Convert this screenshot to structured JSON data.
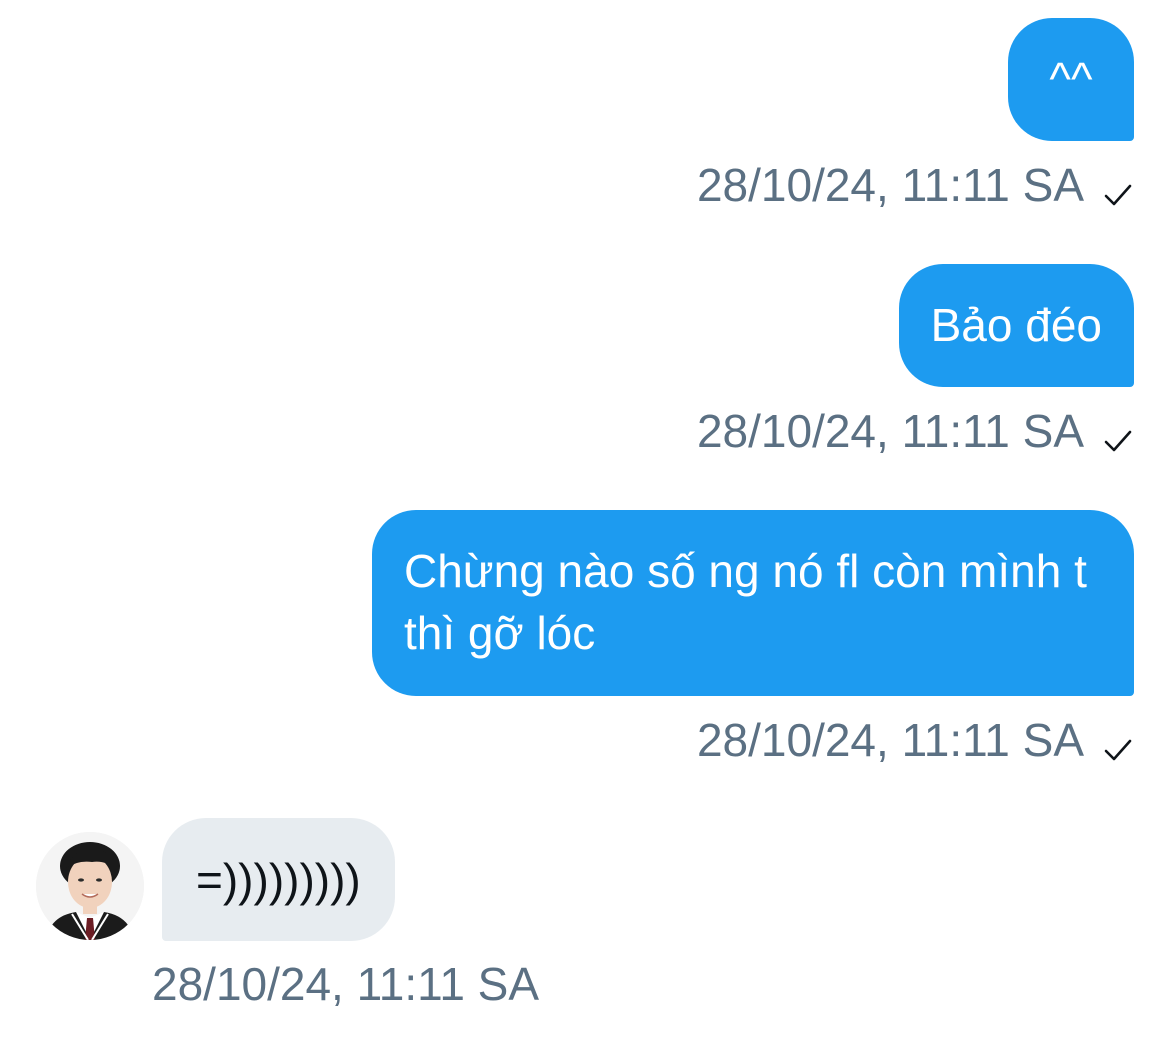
{
  "colors": {
    "outgoing_bubble": "#1d9bf0",
    "incoming_bubble": "#e7ecf0",
    "timestamp_text": "#5b7083"
  },
  "messages": [
    {
      "direction": "outgoing",
      "text": "^^",
      "timestamp": "28/10/24, 11:11 SA",
      "status_icon": "checkmark-icon"
    },
    {
      "direction": "outgoing",
      "text": "Bảo đéo",
      "timestamp": "28/10/24, 11:11 SA",
      "status_icon": "checkmark-icon"
    },
    {
      "direction": "outgoing",
      "text": "Chừng nào số ng nó fl còn mình t thì gỡ lóc",
      "timestamp": "28/10/24, 11:11 SA",
      "status_icon": "checkmark-icon"
    },
    {
      "direction": "incoming",
      "text": "=)))))))))",
      "timestamp": "28/10/24, 11:11 SA",
      "avatar_icon": "avatar-photo"
    }
  ]
}
